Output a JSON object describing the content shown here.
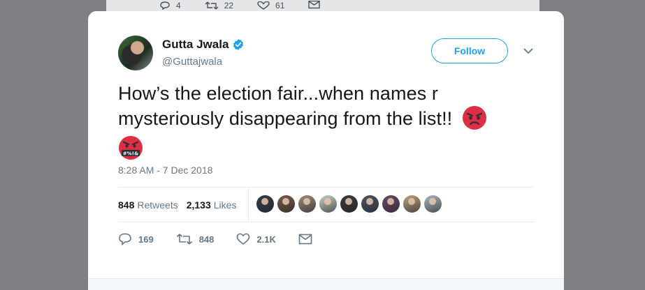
{
  "background_tweet": {
    "reply_count": "4",
    "retweet_count": "22",
    "like_count": "61"
  },
  "tweet": {
    "author_name": "Gutta Jwala",
    "author_handle": "@Guttajwala",
    "follow_label": "Follow",
    "text": "How’s the election fair...when names r mysteriously disappearing from the list!!",
    "timestamp": "8:28 AM - 7 Dec 2018",
    "retweets_count": "848",
    "retweets_label": "Retweets",
    "likes_count": "2,133",
    "likes_label": "Likes",
    "action_replies": "169",
    "action_retweets": "848",
    "action_likes": "2.1K"
  },
  "likers": [
    {
      "color": "#2f3e4e"
    },
    {
      "color": "#7a5a4a"
    },
    {
      "color": "#9a8c7c"
    },
    {
      "color": "#c7d3c1"
    },
    {
      "color": "#3a3a3a"
    },
    {
      "color": "#4a5666"
    },
    {
      "color": "#6a4a6a"
    },
    {
      "color": "#b9a27f"
    },
    {
      "color": "#aab8c2"
    }
  ],
  "colors": {
    "accent": "#1da1f2",
    "verified": "#1da1f2",
    "muted": "#657786",
    "text": "#14171a"
  },
  "icons": {
    "verified": "verified-badge-icon",
    "caret": "chevron-down-icon",
    "reply": "reply-icon",
    "retweet": "retweet-icon",
    "like": "heart-icon",
    "dm": "mail-icon",
    "angry": "angry-face-emoji",
    "cursing": "cursing-face-emoji"
  }
}
